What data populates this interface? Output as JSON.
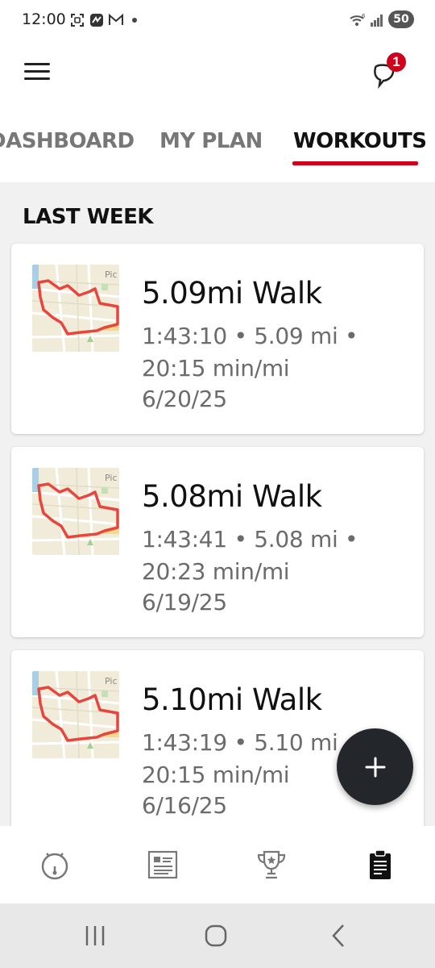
{
  "status_bar": {
    "time": "12:00",
    "battery": "50"
  },
  "app_bar": {
    "notification_count": "1"
  },
  "tabs": [
    {
      "label": "DASHBOARD",
      "active": false
    },
    {
      "label": "MY PLAN",
      "active": false
    },
    {
      "label": "WORKOUTS",
      "active": true
    }
  ],
  "section_title": "LAST WEEK",
  "workouts": [
    {
      "title": "5.09mi Walk",
      "line1": "1:43:10 • 5.09 mi •",
      "line2": "20:15 min/mi",
      "date": "6/20/25"
    },
    {
      "title": "5.08mi Walk",
      "line1": "1:43:41 • 5.08 mi •",
      "line2": "20:23 min/mi",
      "date": "6/19/25"
    },
    {
      "title": "5.10mi Walk",
      "line1": "1:43:19 • 5.10 mi •",
      "line2": "20:15 min/mi",
      "date": "6/16/25"
    }
  ],
  "map_label": "Pic",
  "fab_icon": "plus-icon",
  "bottom_nav": [
    {
      "icon": "stopwatch-icon",
      "active": false
    },
    {
      "icon": "training-plan-icon",
      "active": false
    },
    {
      "icon": "trophy-icon",
      "active": false
    },
    {
      "icon": "clipboard-icon",
      "active": true
    }
  ],
  "colors": {
    "accent": "#d0021b",
    "route": "#e8453c",
    "fab": "#23272b",
    "background": "#f1f1f1"
  }
}
